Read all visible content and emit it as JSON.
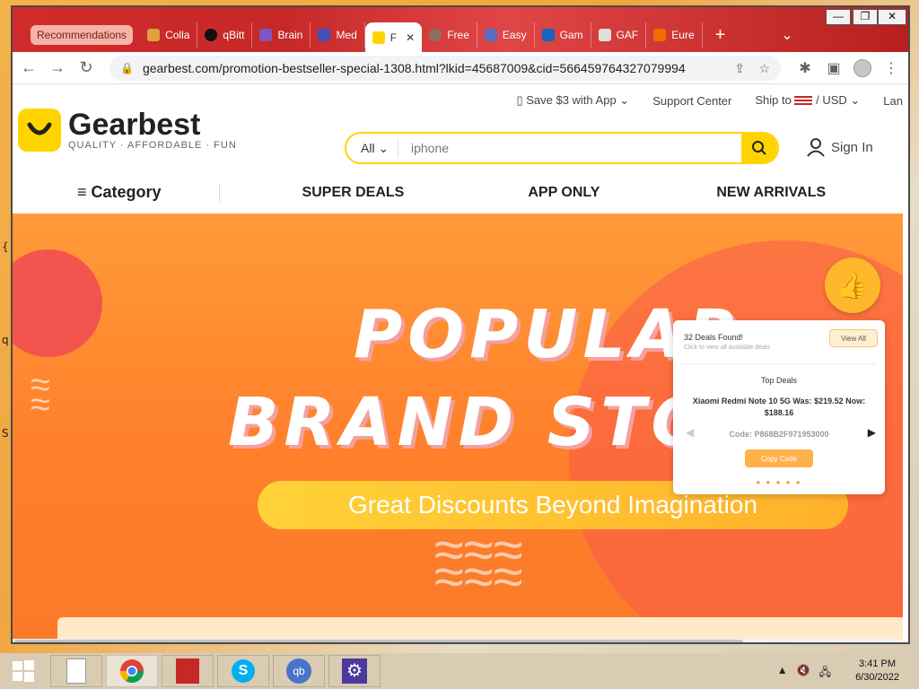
{
  "window_controls": {
    "minimize": "—",
    "maximize": "❐",
    "close": "✕"
  },
  "tabs": {
    "recommendations": "Recommendations",
    "items": [
      {
        "label": "Colla",
        "fav_color": "#e2a03a"
      },
      {
        "label": "qBitt",
        "fav_color": "#111111"
      },
      {
        "label": "Brain",
        "fav_color": "#7e57c2"
      },
      {
        "label": "Med",
        "fav_color": "#3f51b5"
      },
      {
        "label": "F",
        "fav_color": "#ffd400",
        "active": true
      },
      {
        "label": "Free",
        "fav_color": "#8d6e63"
      },
      {
        "label": "Easy",
        "fav_color": "#5c6bc0"
      },
      {
        "label": "Gam",
        "fav_color": "#1565c0"
      },
      {
        "label": "GAF",
        "fav_color": "#e0e0e0"
      },
      {
        "label": "Eure",
        "fav_color": "#ef6c00"
      }
    ],
    "new_tab": "+",
    "tab_close": "✕",
    "tab_menu": "⌄"
  },
  "toolbar": {
    "url": "gearbest.com/promotion-bestseller-special-1308.html?lkid=45687009&cid=566459764327079994"
  },
  "header": {
    "app_promo": "Save $3 with App",
    "support": "Support Center",
    "ship_to": "Ship to",
    "currency": "/ USD",
    "language": "Lan"
  },
  "logo": {
    "name": "Gearbest",
    "tagline": "QUALITY · AFFORDABLE · FUN"
  },
  "search": {
    "category": "All",
    "placeholder": "iphone"
  },
  "signin": {
    "label": "Sign In"
  },
  "nav": {
    "category": "Category",
    "super_deals": "SUPER DEALS",
    "app_only": "APP ONLY",
    "new_arrivals": "NEW ARRIVALS"
  },
  "banner": {
    "line1": "POPULAR",
    "line2": "BRAND STO",
    "subtitle": "Great Discounts Beyond Imagination"
  },
  "deals_popup": {
    "found": "32 Deals Found!",
    "hint": "Click to view all available deals",
    "view_all": "View All",
    "top_deals": "Top Deals",
    "product": "Xiaomi Redmi Note 10 5G Was: $219.52 Now: $188.16",
    "code": "Code: P868B2F971953000",
    "copy": "Copy Code"
  },
  "desktop": {
    "glyphs": [
      "{",
      "q",
      "S"
    ]
  },
  "taskbar": {
    "apps": [
      "file-explorer",
      "chrome",
      "acrobat",
      "skype",
      "qbittorrent",
      "settings"
    ],
    "time": "3:41 PM",
    "date": "6/30/2022"
  }
}
